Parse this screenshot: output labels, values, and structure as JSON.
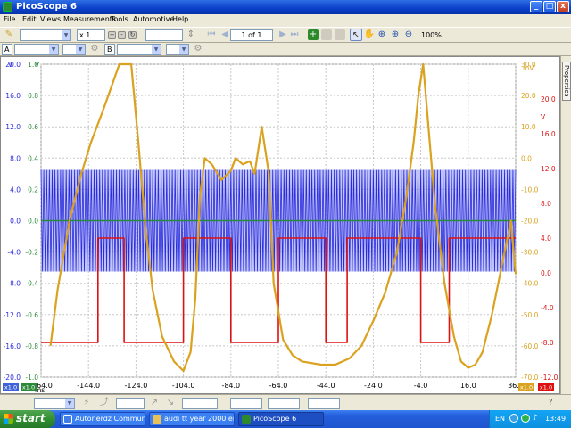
{
  "window": {
    "title": "PicoScope 6",
    "buttons": {
      "minimize": "_",
      "maximize": "□",
      "close": "x"
    }
  },
  "menu": [
    "File",
    "Edit",
    "Views",
    "Measurements",
    "Tools",
    "Automotive",
    "Help"
  ],
  "toolbar": {
    "zoom_multiplier": "x 1",
    "buffer_position": "1 of 1",
    "zoom_level": "100%",
    "channel_a_label": "A",
    "channel_b_label": "B"
  },
  "properties_tab": "Properties",
  "statusbar": {
    "left_badge": "x1.0",
    "left_badge2": "x1.0",
    "units": "ms",
    "right_badge": "x1.0",
    "right_badge2": "x1.0"
  },
  "taskbar": {
    "start_label": "start",
    "tasks": [
      {
        "label": "Autonerdz Communit...",
        "color": "#3f7ee8"
      },
      {
        "label": "audi tt year 2000 eng...",
        "color": "#e8c15a"
      },
      {
        "label": "PicoScope 6",
        "color": "#2c8a2c"
      }
    ],
    "language": "EN",
    "clock": "13:49"
  },
  "colors": {
    "blue": "#2a2cdb",
    "blue_fill": "#8c93f4",
    "red": "#dd1111",
    "green": "#2a8a3a",
    "orange": "#daa21f"
  },
  "chart_data": {
    "type": "line",
    "xlabel": "ms",
    "xlim": [
      -164.0,
      36.0
    ],
    "x_ticks": [
      -164.0,
      -144.0,
      -124.0,
      -104.0,
      -84.0,
      -64.0,
      -44.0,
      -24.0,
      -4.0,
      16.0,
      36.0
    ],
    "axes": [
      {
        "id": "A",
        "side": "left",
        "unit": "V",
        "color": "#2a2cdb",
        "range": [
          -20.0,
          20.0
        ],
        "ticks": [
          "20.0",
          "16.0",
          "12.0",
          "8.0",
          "4.0",
          "0.0",
          "-4.0",
          "-8.0",
          "-12.0",
          "-16.0",
          "-20.0"
        ]
      },
      {
        "id": "B",
        "side": "left",
        "unit": "V",
        "color": "#2a8a3a",
        "range": [
          -1.0,
          1.0
        ],
        "ticks": [
          "1.0",
          "0.8",
          "0.6",
          "0.4",
          "0.2",
          "0.0",
          "-0.2",
          "-0.4",
          "-0.6",
          "-0.8",
          "-1.0"
        ]
      },
      {
        "id": "C",
        "side": "right",
        "unit": "mV",
        "color": "#daa21f",
        "range": [
          -70.0,
          30.0
        ],
        "ticks": [
          "30.0",
          "20.0",
          "10.0",
          "0.0",
          "-10.0",
          "-20.0",
          "-30.0",
          "-40.0",
          "-50.0",
          "-60.0",
          "-70.0"
        ]
      },
      {
        "id": "D",
        "side": "right",
        "unit": "V",
        "color": "#dd1111",
        "range": [
          -12.0,
          24.0
        ],
        "ticks": [
          "20.0",
          "16.0",
          "12.0",
          "8.0",
          "4.0",
          "0.0",
          "-4.0",
          "-8.0",
          "-12.0"
        ]
      }
    ],
    "series": [
      {
        "axis": "A",
        "color": "#2a2cdb",
        "oscillation": {
          "x_range": [
            -164.0,
            36.0
          ],
          "cycles": 170,
          "center": 0.0,
          "amplitude": 6.5
        }
      },
      {
        "axis": "B",
        "color": "#2a8a3a",
        "x": [
          -164.0,
          36.0
        ],
        "y": [
          0.0,
          0.0
        ]
      },
      {
        "axis": "D",
        "color": "#dd1111",
        "x": [
          -164.0,
          -140.0,
          -140.0,
          -129.0,
          -129.0,
          -104.0,
          -104.0,
          -84.0,
          -84.0,
          -64.0,
          -64.0,
          -44.0,
          -44.0,
          -35.0,
          -35.0,
          -4.0,
          -4.0,
          8.0,
          8.0,
          36.0
        ],
        "y": [
          -8.0,
          -8.0,
          4.0,
          4.0,
          -8.0,
          -8.0,
          4.0,
          4.0,
          -8.0,
          -8.0,
          4.0,
          4.0,
          -8.0,
          -8.0,
          4.0,
          4.0,
          -8.0,
          -8.0,
          4.0,
          4.0
        ]
      },
      {
        "axis": "C",
        "color": "#daa21f",
        "x": [
          -160.0,
          -157.0,
          -152.0,
          -147.0,
          -143.0,
          -138.0,
          -131.0,
          -126.0,
          -123.0,
          -120.0,
          -117.0,
          -113.0,
          -108.0,
          -104.0,
          -101.0,
          -99.0,
          -97.0,
          -95.0,
          -92.0,
          -88.0,
          -84.0,
          -82.0,
          -79.0,
          -76.0,
          -74.0,
          -71.0,
          -68.0,
          -66.0,
          -62.0,
          -58.0,
          -54.0,
          -46.0,
          -40.0,
          -34.0,
          -29.0,
          -24.0,
          -19.0,
          -14.0,
          -10.0,
          -7.0,
          -5.0,
          -3.0,
          -1.0,
          2.0,
          6.0,
          10.0,
          13.0,
          16.0,
          19.0,
          22.0,
          26.0,
          30.0,
          34.0,
          36.0
        ],
        "y": [
          -60.0,
          -42.0,
          -20.0,
          -5.0,
          5.0,
          15.0,
          30.0,
          30.0,
          5.0,
          -22.0,
          -42.0,
          -57.0,
          -65.0,
          -68.0,
          -62.0,
          -45.0,
          -12.0,
          0.0,
          -2.0,
          -7.0,
          -4.0,
          0.0,
          -2.0,
          -1.0,
          -5.0,
          10.0,
          -5.0,
          -40.0,
          -58.0,
          -63.0,
          -65.0,
          -66.0,
          -66.0,
          -64.0,
          -60.0,
          -52.0,
          -43.0,
          -30.0,
          -12.0,
          5.0,
          20.0,
          30.0,
          12.0,
          -15.0,
          -40.0,
          -57.0,
          -65.0,
          -67.0,
          -66.0,
          -62.0,
          -50.0,
          -35.0,
          -20.0,
          -37.0
        ]
      }
    ]
  }
}
